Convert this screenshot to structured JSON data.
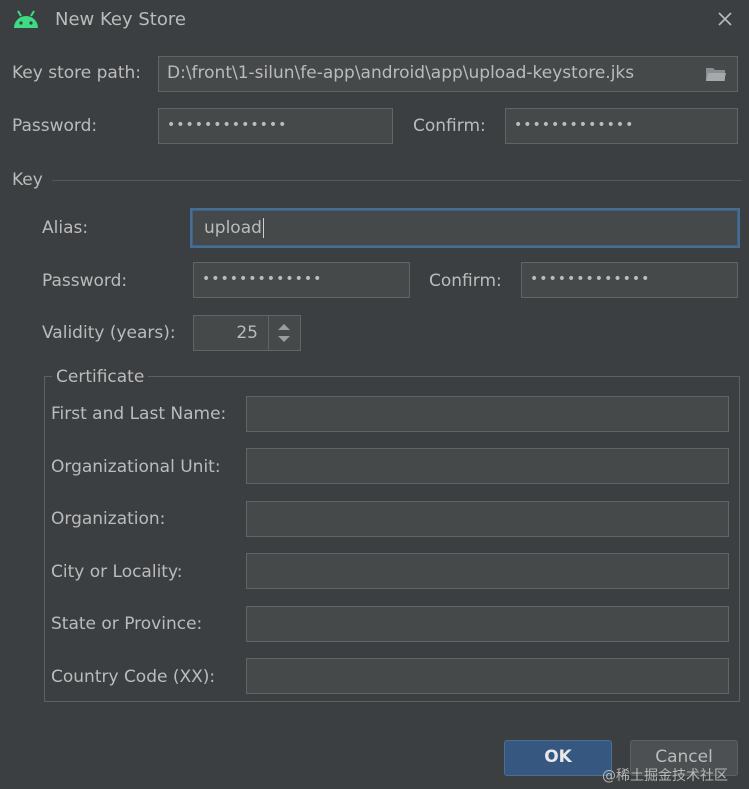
{
  "window": {
    "title": "New Key Store"
  },
  "keystore": {
    "path_label": "Key store path:",
    "path_value": "D:\\front\\1-silun\\fe-app\\android\\app\\upload-keystore.jks",
    "password_label": "Password:",
    "password_value": "•••••••••••••",
    "confirm_label": "Confirm:",
    "confirm_value": "•••••••••••••"
  },
  "key": {
    "section_label": "Key",
    "alias_label": "Alias:",
    "alias_value": "upload",
    "password_label": "Password:",
    "password_value": "•••••••••••••",
    "confirm_label": "Confirm:",
    "confirm_value": "•••••••••••••",
    "validity_label": "Validity (years):",
    "validity_value": "25"
  },
  "certificate": {
    "legend": "Certificate",
    "fields": [
      {
        "label": "First and Last Name:",
        "value": ""
      },
      {
        "label": "Organizational Unit:",
        "value": ""
      },
      {
        "label": "Organization:",
        "value": ""
      },
      {
        "label": "City or Locality:",
        "value": ""
      },
      {
        "label": "State or Province:",
        "value": ""
      },
      {
        "label": "Country Code (XX):",
        "value": ""
      }
    ]
  },
  "buttons": {
    "ok": "OK",
    "cancel": "Cancel"
  },
  "watermark": "@稀土掘金技术社区",
  "colors": {
    "background": "#3c3f41",
    "field": "#45494a",
    "accent": "#365880",
    "android": "#3ddc84"
  }
}
